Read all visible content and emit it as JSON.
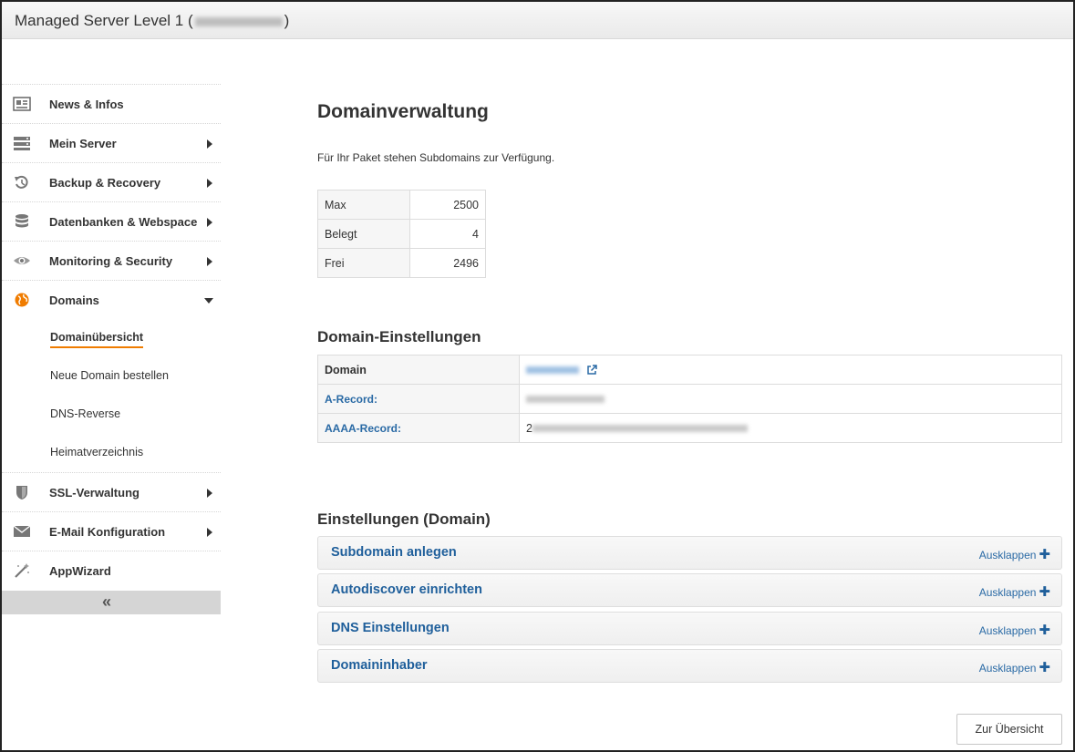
{
  "window": {
    "title_prefix": "Managed Server Level 1 (",
    "title_suffix": ")"
  },
  "sidebar": {
    "items": [
      {
        "label": "News & Infos",
        "icon": "newspaper-icon"
      },
      {
        "label": "Mein Server",
        "icon": "server-icon"
      },
      {
        "label": "Backup & Recovery",
        "icon": "history-icon"
      },
      {
        "label": "Datenbanken & Webspace",
        "icon": "database-icon"
      },
      {
        "label": "Monitoring & Security",
        "icon": "eye-icon"
      },
      {
        "label": "Domains",
        "icon": "globe-icon"
      },
      {
        "label": "SSL-Verwaltung",
        "icon": "shield-icon"
      },
      {
        "label": "E-Mail Konfiguration",
        "icon": "envelope-icon"
      },
      {
        "label": "AppWizard",
        "icon": "magic-wand-icon"
      }
    ],
    "domains_sub": [
      {
        "label": "Domainübersicht"
      },
      {
        "label": "Neue Domain bestellen"
      },
      {
        "label": "DNS-Reverse"
      },
      {
        "label": "Heimatverzeichnis"
      }
    ],
    "collapse_label": "«",
    "accent_color": "#f07c00"
  },
  "main": {
    "title": "Domainverwaltung",
    "intro": "Für Ihr Paket stehen Subdomains zur Verfügung.",
    "quota": [
      {
        "key": "Max",
        "value": "2500"
      },
      {
        "key": "Belegt",
        "value": "4"
      },
      {
        "key": "Frei",
        "value": "2496"
      }
    ],
    "domain_settings": {
      "heading": "Domain-Einstellungen",
      "rows": [
        {
          "key": "Domain"
        },
        {
          "key": "A-Record:"
        },
        {
          "key": "AAAA-Record:",
          "value_prefix": "2"
        }
      ]
    },
    "settings_heading": "Einstellungen (Domain)",
    "accordions": [
      {
        "title": "Subdomain anlegen",
        "toggle": "Ausklappen"
      },
      {
        "title": "Autodiscover einrichten",
        "toggle": "Ausklappen"
      },
      {
        "title": "DNS Einstellungen",
        "toggle": "Ausklappen"
      },
      {
        "title": "Domaininhaber",
        "toggle": "Ausklappen"
      }
    ],
    "back_button": "Zur Übersicht",
    "link_color": "#1f5f9b"
  }
}
